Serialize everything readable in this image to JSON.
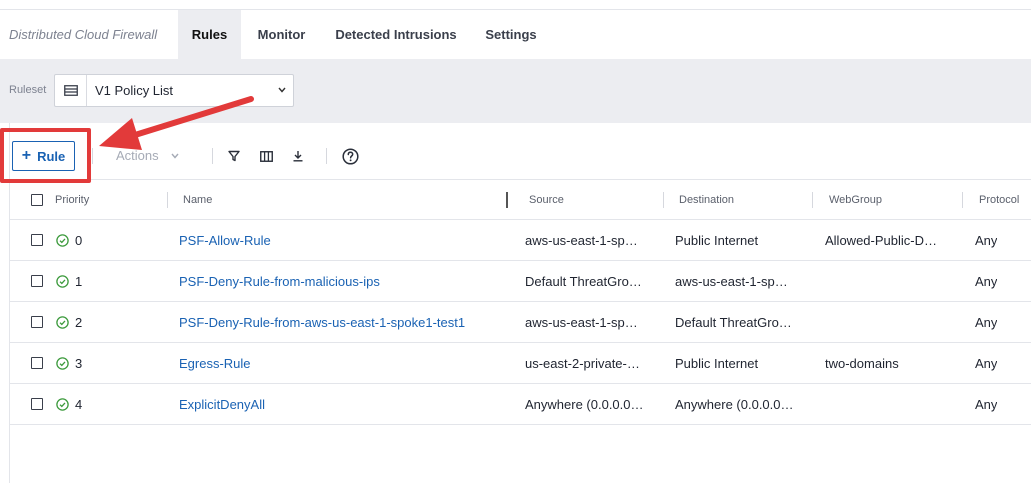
{
  "header": {
    "app_title": "Distributed Cloud Firewall",
    "tabs": [
      {
        "label": "Rules",
        "active": true
      },
      {
        "label": "Monitor",
        "active": false
      },
      {
        "label": "Detected Intrusions",
        "active": false
      },
      {
        "label": "Settings",
        "active": false
      }
    ]
  },
  "ruleset": {
    "label": "Ruleset",
    "selected": "V1 Policy List",
    "icon": "list-icon"
  },
  "toolbar": {
    "add_rule_label": "Rule",
    "actions_label": "Actions",
    "icons": [
      "filter-icon",
      "columns-icon",
      "download-icon",
      "help-icon"
    ]
  },
  "annotation": {
    "highlight_color": "#e23a3a"
  },
  "table": {
    "columns": [
      "Priority",
      "Name",
      "Source",
      "Destination",
      "WebGroup",
      "Protocol"
    ],
    "rows": [
      {
        "priority": "0",
        "name": "PSF-Allow-Rule",
        "source": "aws-us-east-1-sp…",
        "destination": "Public Internet",
        "webgroup": "Allowed-Public-D…",
        "protocol": "Any",
        "status": "enabled"
      },
      {
        "priority": "1",
        "name": "PSF-Deny-Rule-from-malicious-ips",
        "source": "Default ThreatGro…",
        "destination": "aws-us-east-1-sp…",
        "webgroup": "",
        "protocol": "Any",
        "status": "enabled"
      },
      {
        "priority": "2",
        "name": "PSF-Deny-Rule-from-aws-us-east-1-spoke1-test1",
        "source": "aws-us-east-1-sp…",
        "destination": "Default ThreatGro…",
        "webgroup": "",
        "protocol": "Any",
        "status": "enabled"
      },
      {
        "priority": "3",
        "name": "Egress-Rule",
        "source": "us-east-2-private-…",
        "destination": "Public Internet",
        "webgroup": "two-domains",
        "protocol": "Any",
        "status": "enabled"
      },
      {
        "priority": "4",
        "name": "ExplicitDenyAll",
        "source": "Anywhere (0.0.0.0…",
        "destination": "Anywhere (0.0.0.0…",
        "webgroup": "",
        "protocol": "Any",
        "status": "enabled"
      }
    ]
  },
  "colors": {
    "accent": "#1a62b3",
    "status_ok": "#3c9a3c",
    "band": "#ecedf1"
  }
}
